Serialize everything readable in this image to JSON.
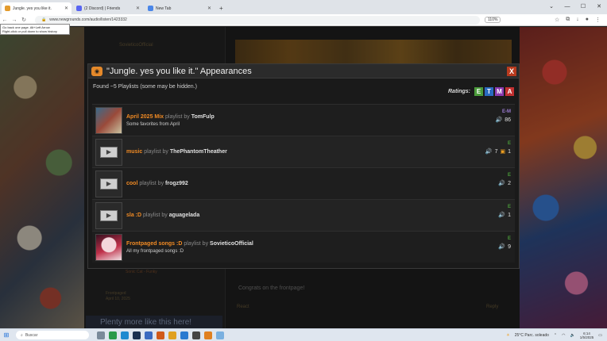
{
  "browser": {
    "tabs": [
      {
        "label": "Jungle. yes you like it.",
        "color": "#e39b2d",
        "active": true
      },
      {
        "label": "(2 Discord) | Friends",
        "color": "#5865f2",
        "active": false
      },
      {
        "label": "New Tab",
        "color": "#4a86e8",
        "active": false
      }
    ],
    "url": "www.newgrounds.com/audio/listen/1423332",
    "zoom": "110%",
    "tooltip": "Go back one page. Alt+Left Arrow\nRight-click or pull down to show history"
  },
  "background": {
    "user_name": "SovieticoOfficial",
    "sonic_label": "Sonic Cat - Funky",
    "frontpaged_label": "Frontpaged",
    "frontpaged_date": "April 10, 2025",
    "comment_text": "Congrats on the frontpage!",
    "react_label": "React",
    "reply_label": "Reply",
    "plenty_label": "Plenty more like this here!"
  },
  "modal": {
    "title": "\"Jungle. yes you like it.\" Appearances",
    "close_label": "X",
    "found_text": "Found ~5 Playlists (some may be hidden.)",
    "ratings_label": "Ratings:",
    "ratings": [
      {
        "letter": "E",
        "color": "#4a9a3a"
      },
      {
        "letter": "T",
        "color": "#2a6ac0"
      },
      {
        "letter": "M",
        "color": "#8a3ab0"
      },
      {
        "letter": "A",
        "color": "#c03030"
      }
    ],
    "by_text": "playlist by",
    "playlists": [
      {
        "name": "April 2025 Mix",
        "author": "TomFulp",
        "description": "Some favorites from April",
        "rating": "E-M",
        "rating_color": "#9a7ad0",
        "listens": "86",
        "comments": ""
      },
      {
        "name": "music",
        "author": "ThePhantomTheather",
        "description": "",
        "rating": "E",
        "rating_color": "#4a9a3a",
        "listens": "7",
        "comments": "1"
      },
      {
        "name": "cool",
        "author": "frogz992",
        "description": "",
        "rating": "E",
        "rating_color": "#4a9a3a",
        "listens": "2",
        "comments": ""
      },
      {
        "name": "sla :D",
        "author": "aguagelada",
        "description": "",
        "rating": "E",
        "rating_color": "#4a9a3a",
        "listens": "1",
        "comments": ""
      },
      {
        "name": "Frontpaged songs :D",
        "author": "SovieticoOfficial",
        "description": "All my frontpaged songs :D",
        "rating": "E",
        "rating_color": "#4a9a3a",
        "listens": "9",
        "comments": ""
      }
    ]
  },
  "taskbar": {
    "search_placeholder": "Buscar",
    "weather": "25°C Parc. soleado",
    "time": "6:14",
    "date": "1/5/2025"
  }
}
